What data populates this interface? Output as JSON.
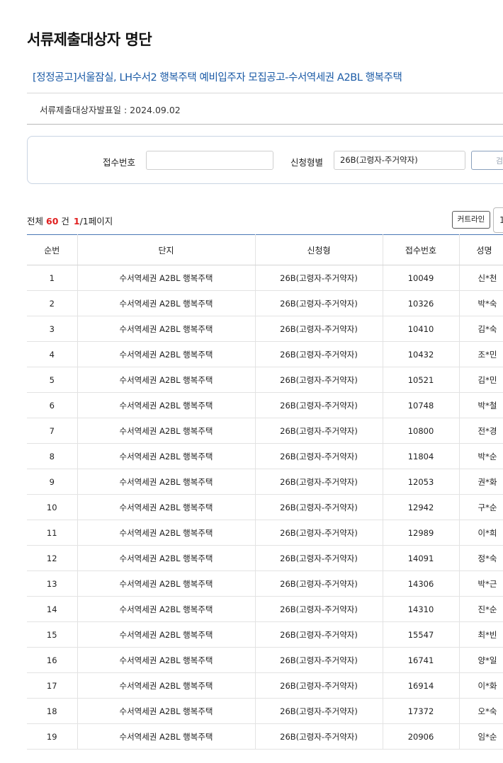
{
  "page": {
    "title": "서류제출대상자 명단",
    "notice_title": "[정정공고]서울잠실, LH수서2 행복주택 예비입주자 모집공고-수서역세권 A2BL 행복주택",
    "pub_date": "서류제출대상자발표일 : 2024.09.02"
  },
  "search": {
    "receipt_label": "접수번호",
    "receipt_value": "",
    "type_label": "신청형별",
    "type_value": "26B(고령자-주거약자)",
    "search_button": "검색"
  },
  "summary": {
    "prefix": "전체",
    "count": "60",
    "unit": "건",
    "page_current": "1",
    "page_suffix": "/1페이지",
    "curtain_button": "커트라인",
    "page_select": "1"
  },
  "table": {
    "headers": [
      "순번",
      "단지",
      "신청형",
      "접수번호",
      "성명"
    ],
    "rows": [
      {
        "no": "1",
        "complex": "수서역세권 A2BL 행복주택",
        "type": "26B(고령자-주거약자)",
        "receipt": "10049",
        "name": "신*천"
      },
      {
        "no": "2",
        "complex": "수서역세권 A2BL 행복주택",
        "type": "26B(고령자-주거약자)",
        "receipt": "10326",
        "name": "박*숙"
      },
      {
        "no": "3",
        "complex": "수서역세권 A2BL 행복주택",
        "type": "26B(고령자-주거약자)",
        "receipt": "10410",
        "name": "김*숙"
      },
      {
        "no": "4",
        "complex": "수서역세권 A2BL 행복주택",
        "type": "26B(고령자-주거약자)",
        "receipt": "10432",
        "name": "조*민"
      },
      {
        "no": "5",
        "complex": "수서역세권 A2BL 행복주택",
        "type": "26B(고령자-주거약자)",
        "receipt": "10521",
        "name": "김*민"
      },
      {
        "no": "6",
        "complex": "수서역세권 A2BL 행복주택",
        "type": "26B(고령자-주거약자)",
        "receipt": "10748",
        "name": "박*철"
      },
      {
        "no": "7",
        "complex": "수서역세권 A2BL 행복주택",
        "type": "26B(고령자-주거약자)",
        "receipt": "10800",
        "name": "전*경"
      },
      {
        "no": "8",
        "complex": "수서역세권 A2BL 행복주택",
        "type": "26B(고령자-주거약자)",
        "receipt": "11804",
        "name": "박*순"
      },
      {
        "no": "9",
        "complex": "수서역세권 A2BL 행복주택",
        "type": "26B(고령자-주거약자)",
        "receipt": "12053",
        "name": "권*화"
      },
      {
        "no": "10",
        "complex": "수서역세권 A2BL 행복주택",
        "type": "26B(고령자-주거약자)",
        "receipt": "12942",
        "name": "구*순"
      },
      {
        "no": "11",
        "complex": "수서역세권 A2BL 행복주택",
        "type": "26B(고령자-주거약자)",
        "receipt": "12989",
        "name": "이*희"
      },
      {
        "no": "12",
        "complex": "수서역세권 A2BL 행복주택",
        "type": "26B(고령자-주거약자)",
        "receipt": "14091",
        "name": "정*숙"
      },
      {
        "no": "13",
        "complex": "수서역세권 A2BL 행복주택",
        "type": "26B(고령자-주거약자)",
        "receipt": "14306",
        "name": "박*근"
      },
      {
        "no": "14",
        "complex": "수서역세권 A2BL 행복주택",
        "type": "26B(고령자-주거약자)",
        "receipt": "14310",
        "name": "진*순"
      },
      {
        "no": "15",
        "complex": "수서역세권 A2BL 행복주택",
        "type": "26B(고령자-주거약자)",
        "receipt": "15547",
        "name": "최*빈"
      },
      {
        "no": "16",
        "complex": "수서역세권 A2BL 행복주택",
        "type": "26B(고령자-주거약자)",
        "receipt": "16741",
        "name": "양*일"
      },
      {
        "no": "17",
        "complex": "수서역세권 A2BL 행복주택",
        "type": "26B(고령자-주거약자)",
        "receipt": "16914",
        "name": "이*화"
      },
      {
        "no": "18",
        "complex": "수서역세권 A2BL 행복주택",
        "type": "26B(고령자-주거약자)",
        "receipt": "17372",
        "name": "오*숙"
      },
      {
        "no": "19",
        "complex": "수서역세권 A2BL 행복주택",
        "type": "26B(고령자-주거약자)",
        "receipt": "20906",
        "name": "임*순"
      }
    ]
  }
}
